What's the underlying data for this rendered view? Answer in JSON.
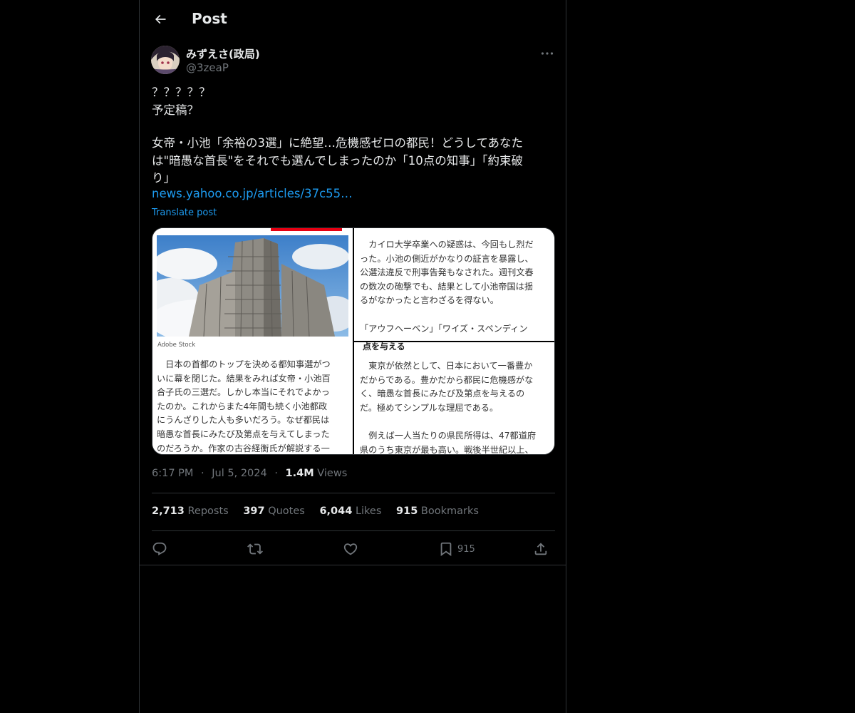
{
  "header": {
    "title": "Post"
  },
  "user": {
    "name": "みずえさ(政局)",
    "handle": "@3zeaP"
  },
  "tweet": {
    "lines": [
      "？？？？？",
      "予定稿？",
      "",
      "女帝・小池「余裕の3選」に絶望…危機感ゼロの都民！どうしてあなた",
      "は\"暗愚な首長\"をそれでも選んでしまったのか「10点の知事」「約束破",
      "り」"
    ],
    "link": "news.yahoo.co.jp/articles/37c55…",
    "translate_label": "Translate post"
  },
  "media": {
    "photo_credit": "Adobe Stock",
    "left_text": [
      "　日本の首都のトップを決める都知事選がつ",
      "いに幕を閉じた。結果をみれば女帝・小池百",
      "合子氏の三選だ。しかし本当にそれでよかっ",
      "たのか。これからまた4年間も続く小池都政",
      "にうんざりした人も多いだろう。なぜ都民は",
      "暗愚な首長にみたび及第点を与えてしまった",
      "のだろうか。作家の古谷経衡氏が解説する一"
    ],
    "top_right_text": [
      "　カイロ大学卒業への疑惑は、今回もし烈だ",
      "った。小池の側近がかなりの証言を暴露し、",
      "公選法違反で刑事告発もなされた。週刊文春",
      "の数次の砲撃でも、結果として小池帝国は揺",
      "るがなかったと言わざるを得ない。",
      "",
      "「アウフヘーベン」「ワイズ・スペンディン"
    ],
    "bottom_right_heading": "点を与える",
    "bottom_right_text": [
      "　東京が依然として、日本において一番豊か",
      "だからである。豊かだから都民に危機感がな",
      "く、暗愚な首長にみたび及第点を与えるの",
      "だ。極めてシンプルな理屈である。",
      "",
      "　例えば一人当たりの県民所得は、47都道府",
      "県のうち東京が最も高い。戦後半世紀以上、"
    ]
  },
  "meta": {
    "time": "6:17 PM",
    "dot": "·",
    "date": "Jul 5, 2024",
    "views_count": "1.4M",
    "views_label": "Views"
  },
  "stats": {
    "reposts_count": "2,713",
    "reposts_label": "Reposts",
    "quotes_count": "397",
    "quotes_label": "Quotes",
    "likes_count": "6,044",
    "likes_label": "Likes",
    "bookmarks_count": "915",
    "bookmarks_label": "Bookmarks"
  },
  "actions": {
    "bookmark_count": "915",
    "icons": [
      "reply-icon",
      "repost-icon",
      "like-icon",
      "bookmark-icon",
      "share-icon"
    ]
  },
  "colors": {
    "background": "#000000",
    "text": "#e7e9ea",
    "muted": "#71767b",
    "link": "#1d9bf0",
    "border": "#2f3336",
    "accent_red": "#e60012"
  }
}
